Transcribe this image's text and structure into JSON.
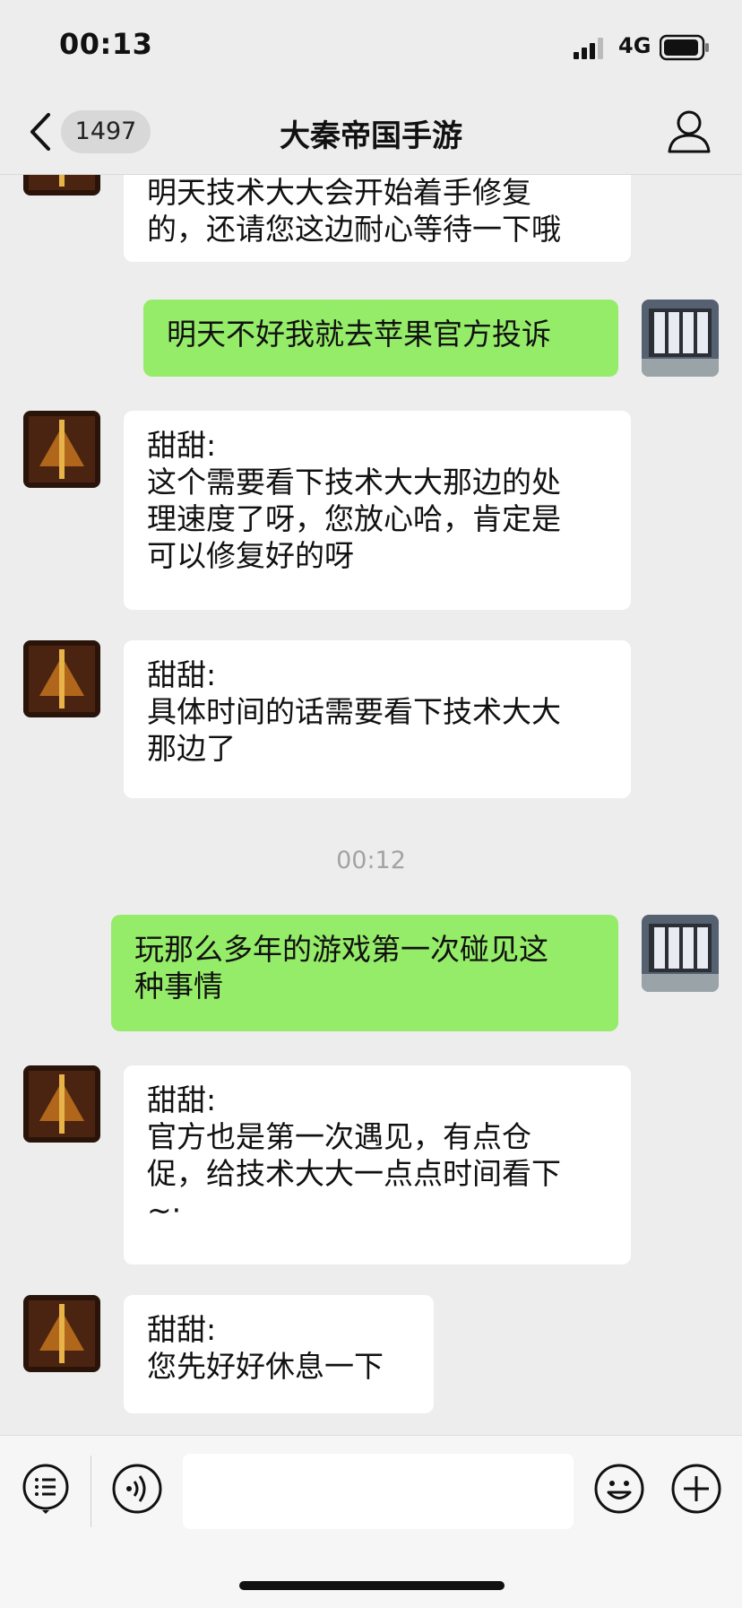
{
  "status_bar": {
    "time": "00:13",
    "network": "4G"
  },
  "nav": {
    "unread_count": "1497",
    "title": "大秦帝国手游"
  },
  "messages": [
    {
      "sender": "",
      "text": "明天技术大大会开始着手修复\n的，还请您这边耐心等待一下哦"
    },
    {
      "sender": "",
      "text": "明天不好我就去苹果官方投诉"
    },
    {
      "sender": "甜甜:",
      "text": "这个需要看下技术大大那边的处\n理速度了呀，您放心哈，肯定是\n可以修复好的呀"
    },
    {
      "sender": "甜甜:",
      "text": "具体时间的话需要看下技术大大\n那边了"
    },
    {
      "sender": "",
      "text": "玩那么多年的游戏第一次碰见这\n种事情"
    },
    {
      "sender": "甜甜:",
      "text": "官方也是第一次遇见，有点仓\n促，给技术大大一点点时间看下\n~·"
    },
    {
      "sender": "甜甜:",
      "text": "您先好好休息一下"
    }
  ],
  "timestamp": "00:12",
  "colors": {
    "background": "#ededed",
    "incoming_bubble": "#ffffff",
    "outgoing_bubble": "#95ec69",
    "timestamp": "#a3a3a3"
  },
  "icons": {
    "back": "chevron-left-icon",
    "contact": "person-icon",
    "menu": "list-menu-icon",
    "voice": "voice-icon",
    "emoji": "smiley-icon",
    "add": "plus-icon"
  }
}
